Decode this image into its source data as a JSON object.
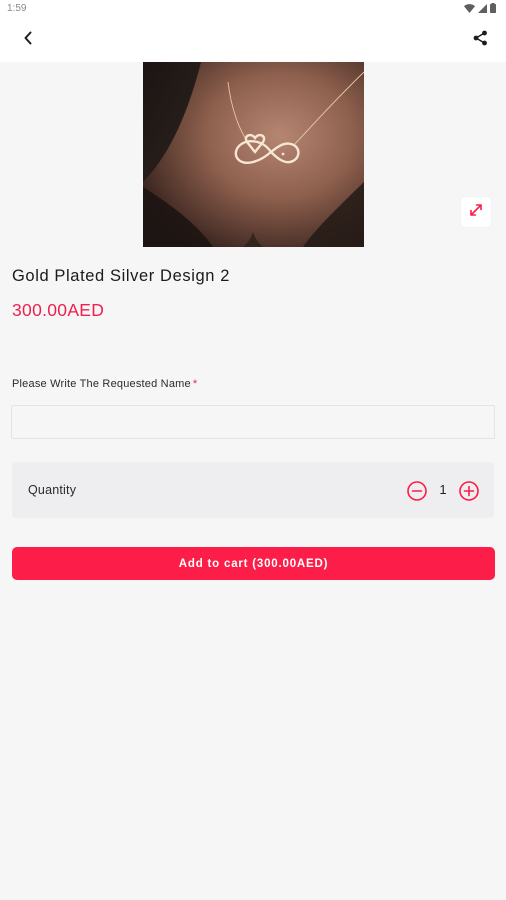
{
  "status_bar": {
    "time": "1:59",
    "icons": [
      "wifi-icon",
      "signal-icon",
      "battery-icon"
    ]
  },
  "app_bar": {
    "back_icon": "chevron-left-icon",
    "share_icon": "share-icon"
  },
  "product": {
    "image": "gold-infinity-heart-necklace-photo",
    "expand_icon": "expand-arrows-icon",
    "title": "Gold Plated Silver Design 2",
    "price": "300.00AED"
  },
  "form": {
    "name_label": "Please Write The Requested Name",
    "required_mark": "*",
    "name_value": "",
    "name_placeholder": ""
  },
  "quantity": {
    "label": "Quantity",
    "value": "1",
    "minus_icon": "minus-circle-icon",
    "plus_icon": "plus-circle-icon"
  },
  "cart_button": {
    "label": "Add to cart (300.00AED)"
  },
  "colors": {
    "accent": "#fc1d48",
    "price": "#ee2150",
    "background": "#f6f6f6",
    "quantity_box": "#eeeef0"
  }
}
